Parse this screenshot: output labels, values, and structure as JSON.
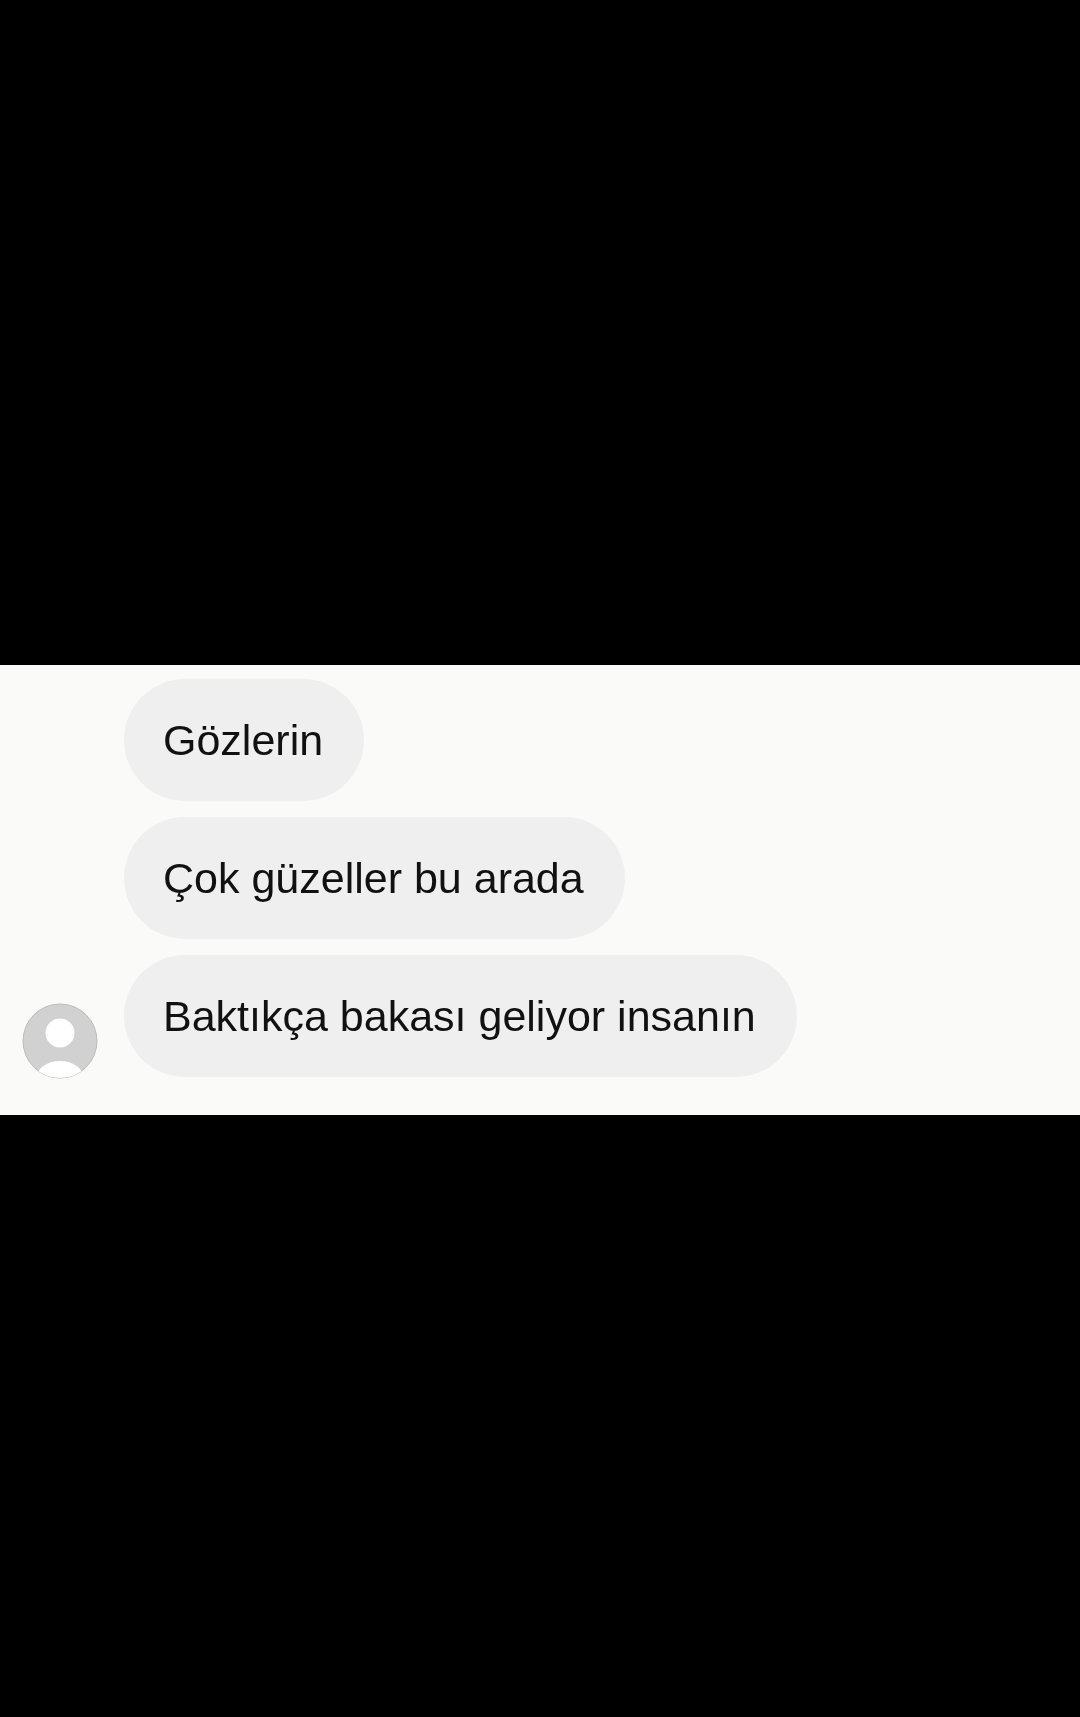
{
  "messages": [
    {
      "text": "Gözlerin",
      "avatar": false
    },
    {
      "text": "Çok güzeller bu arada",
      "avatar": false
    },
    {
      "text": "Baktıkça bakası geliyor insanın",
      "avatar": true
    }
  ]
}
